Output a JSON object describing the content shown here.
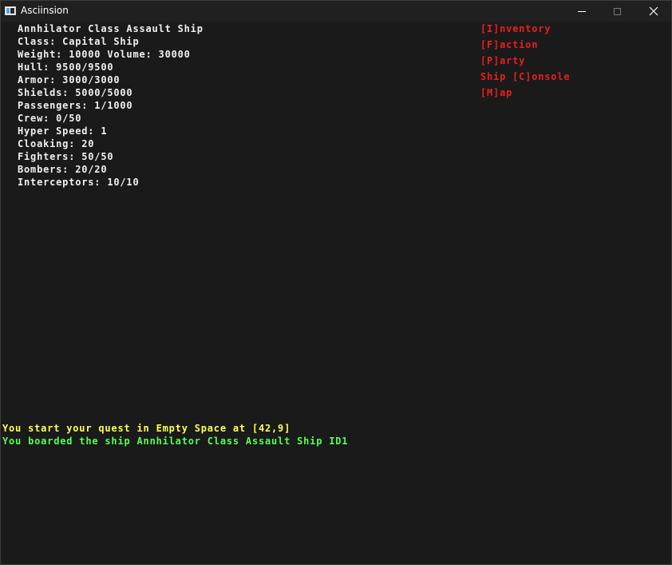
{
  "window": {
    "title": "Asciinsion",
    "icon": "app-icon",
    "controls": [
      "minimize-icon",
      "maximize-icon",
      "close-icon"
    ]
  },
  "ship": {
    "name": "Annhilator Class Assault Ship",
    "class": "Class: Capital Ship",
    "weight_volume": "Weight: 10000 Volume: 30000",
    "hull": "Hull: 9500/9500",
    "armor": "Armor: 3000/3000",
    "shields": "Shields: 5000/5000",
    "passengers": "Passengers: 1/1000",
    "crew": "Crew: 0/50",
    "hyper_speed": "Hyper Speed: 1",
    "cloaking": "Cloaking: 20",
    "fighters": "Fighters: 50/50",
    "bombers": "Bombers: 20/20",
    "interceptors": "Interceptors: 10/10"
  },
  "menu": {
    "inventory": "[I]nventory",
    "faction": "[F]action",
    "party": "[P]arty",
    "console": "Ship [C]onsole",
    "map": "[M]ap"
  },
  "log": {
    "line1": "You start your quest in Empty Space at [42,9]",
    "line2": "You boarded the ship Annhilator Class Assault Ship ID1"
  },
  "colors": {
    "background": "#1a1a1a",
    "titlebar": "#202020",
    "stat_text": "#f0f0f0",
    "menu_text": "#e8201c",
    "log_yellow": "#ffff55",
    "log_green": "#55ff55"
  }
}
